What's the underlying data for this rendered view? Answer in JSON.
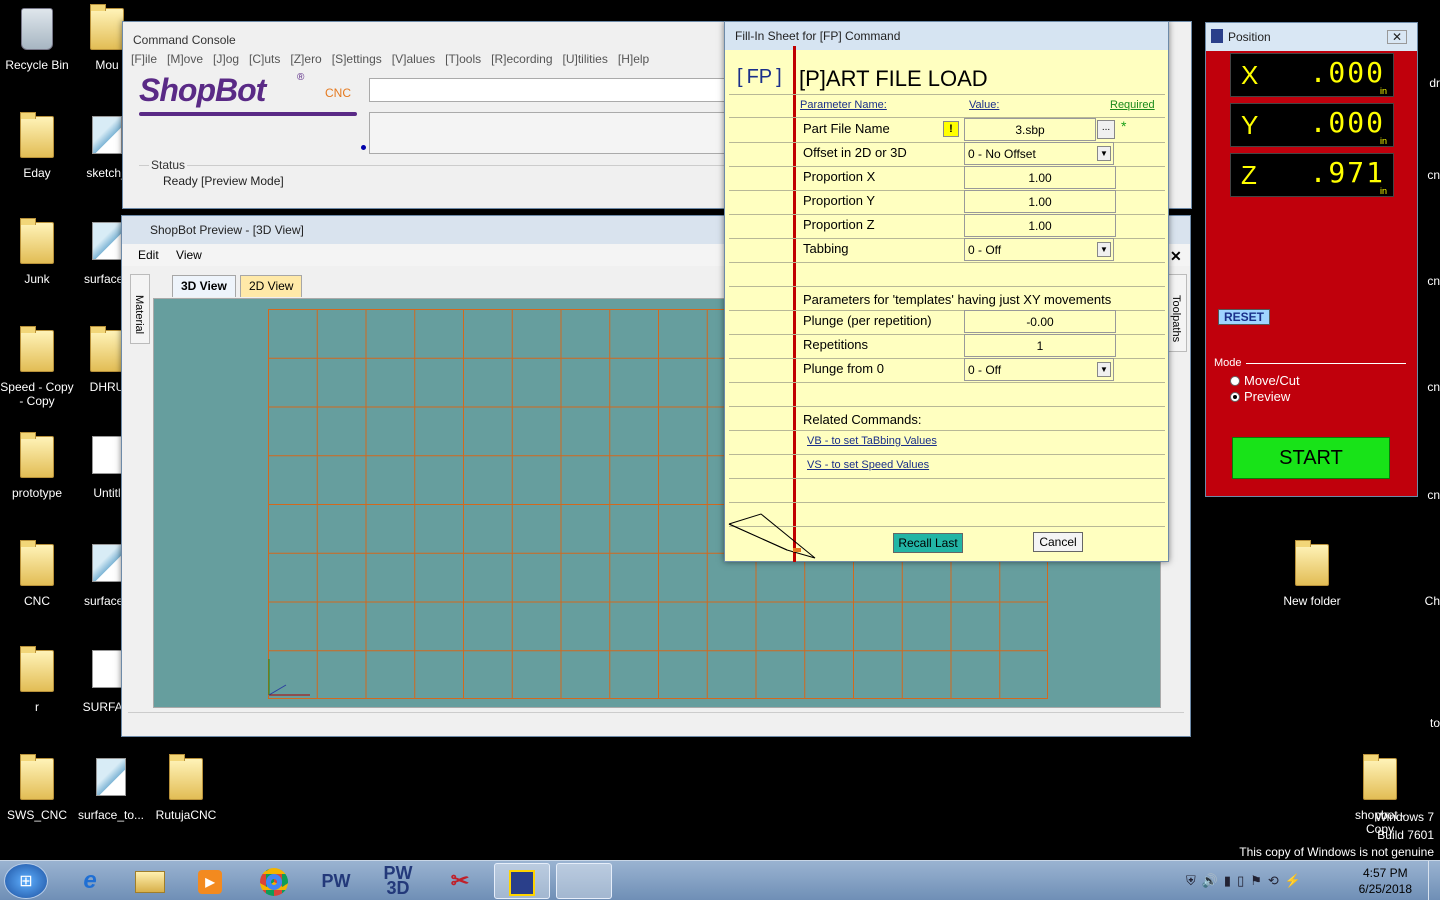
{
  "desktop": {
    "icons": [
      {
        "label": "Recycle Bin"
      },
      {
        "label": "Mou"
      },
      {
        "label": "Eday"
      },
      {
        "label": "sketch_"
      },
      {
        "label": "Junk"
      },
      {
        "label": "surface_"
      },
      {
        "label": "Speed - Copy - Copy"
      },
      {
        "label": "DHRU"
      },
      {
        "label": "prototype"
      },
      {
        "label": "Untitl"
      },
      {
        "label": "CNC"
      },
      {
        "label": "surface_"
      },
      {
        "label": "r"
      },
      {
        "label": "SURFAC"
      },
      {
        "label": "SWS_CNC"
      },
      {
        "label": "surface_to..."
      },
      {
        "label": "RutujaCNC"
      },
      {
        "label": "New folder"
      },
      {
        "label": "shopbot - Copy"
      }
    ],
    "edge_labels": [
      "dr",
      "cn",
      "cn",
      "cn",
      "cn",
      "Ch",
      "to"
    ],
    "watermark": {
      "line1": "Windows 7",
      "line2": "Build 7601",
      "line3": "This copy of Windows is not genuine"
    }
  },
  "console": {
    "title": "Command Console",
    "menu": [
      "[F]ile",
      "[M]ove",
      "[J]og",
      "[C]uts",
      "[Z]ero",
      "[S]ettings",
      "[V]alues",
      "[T]ools",
      "[R]ecording",
      "[U]tilities",
      "[H]elp"
    ],
    "logo_text": "ShopBot",
    "logo_reg": "®",
    "logo_sub": "CNC",
    "status_label": "Status",
    "status_value": "Ready  [Preview Mode]"
  },
  "preview": {
    "title": "ShopBot Preview - [3D View]",
    "menu": [
      "Edit",
      "View"
    ],
    "tabs": [
      "3D View",
      "2D View"
    ],
    "side_left": "Material",
    "side_right": "Toolpaths"
  },
  "fillin": {
    "title": "Fill-In Sheet for [FP] Command",
    "cmd": "FP",
    "heading": "[P]ART FILE LOAD",
    "col_param": "Parameter Name:",
    "col_value": "Value:",
    "col_required": "Required",
    "rows": [
      {
        "label": "Part File Name",
        "value": "3.sbp"
      },
      {
        "label": "Offset in 2D or 3D",
        "value": "0 - No Offset"
      },
      {
        "label": "Proportion X",
        "value": "1.00"
      },
      {
        "label": "Proportion Y",
        "value": "1.00"
      },
      {
        "label": "Proportion Z",
        "value": "1.00"
      },
      {
        "label": "Tabbing",
        "value": "0 - Off"
      }
    ],
    "templates_header": "Parameters for 'templates' having just XY movements",
    "rows2": [
      {
        "label": "Plunge (per repetition)",
        "value": "-0.00"
      },
      {
        "label": "Repetitions",
        "value": "1"
      },
      {
        "label": "Plunge from 0",
        "value": "0 - Off"
      }
    ],
    "related_header": "Related Commands:",
    "links": [
      "VB - to set TaBbing Values",
      "VS - to set Speed Values"
    ],
    "warn": "!",
    "browse": "...",
    "required_mark": "*",
    "recall_btn": "Recall Last",
    "cancel_btn": "Cancel"
  },
  "position": {
    "title": "Position",
    "axes": [
      {
        "axis": "X",
        "value": ".000",
        "unit": "in"
      },
      {
        "axis": "Y",
        "value": ".000",
        "unit": "in"
      },
      {
        "axis": "Z",
        "value": ".971",
        "unit": "in"
      }
    ],
    "reset": "RESET",
    "mode_label": "Mode",
    "modes": [
      "Move/Cut",
      "Preview"
    ],
    "mode_selected": "Preview",
    "start": "START"
  },
  "taskbar": {
    "items": [
      "IE",
      "Explorer",
      "Media",
      "Chrome",
      "PW",
      "PW 3D",
      "Snip",
      "ShopBot",
      ""
    ],
    "time": "4:57 PM",
    "date": "6/25/2018"
  },
  "colors": {
    "fillin_bg": "#ffffc0",
    "position_bg": "#c0000c",
    "start_green": "#18e318",
    "canvas": "#669e9e",
    "grid": "#d2691e"
  }
}
